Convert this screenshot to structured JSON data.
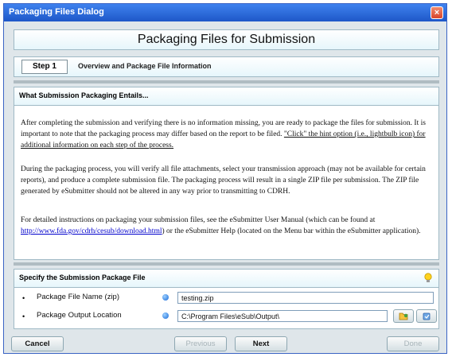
{
  "window": {
    "title": "Packaging Files Dialog",
    "close_label": "×"
  },
  "header": {
    "title": "Packaging Files for Submission"
  },
  "step": {
    "number": "Step 1",
    "title": "Overview and Package File Information"
  },
  "overview": {
    "heading": "What Submission Packaging Entails...",
    "p1": "After completing the submission and verifying there is no information missing, you are ready to package the files for submission. It is important to note that the packaging process may differ based on the report to be filed.",
    "p1_link": "\"Click\" the hint option (i.e., lightbulb icon) for additional information on each step of the process.",
    "p2": "During the packaging process, you will verify all file attachments, select your transmission approach (may not be available for certain reports), and produce a complete submission file. The packaging process will result in a single ZIP file per submission. The ZIP file generated by eSubmitter should not be altered in any way prior to transmitting to CDRH.",
    "p3_before": "For detailed instructions on packaging your submission files, see the eSubmitter User Manual (which can be found at",
    "p3_link": "http://www.fda.gov/cdrh/cesub/download.html",
    "p3_after": ") or the eSubmitter Help (located on the Menu bar within the eSubmitter application)."
  },
  "specify": {
    "heading": "Specify the Submission Package File",
    "hint_icon": "lightbulb-icon",
    "rows": [
      {
        "bullet": "•",
        "label": "Package File Name (zip)",
        "value": "testing.zip"
      },
      {
        "bullet": "•",
        "label": "Package Output Location",
        "value": "C:\\Program Files\\eSub\\Output\\"
      }
    ]
  },
  "footer": {
    "cancel": "Cancel",
    "previous": "Previous",
    "next": "Next",
    "done": "Done"
  },
  "colors": {
    "titlebar": "#1e57c8",
    "link": "#0000cc",
    "panel_border": "#9fb9c5",
    "window_bg": "#dfe6ea"
  }
}
